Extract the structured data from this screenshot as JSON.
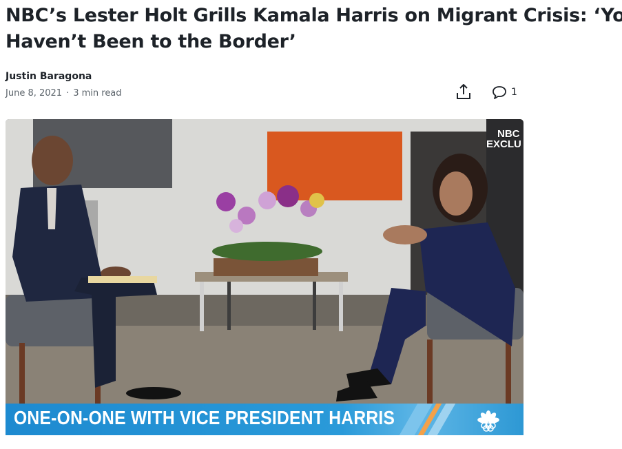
{
  "article": {
    "headline_line1": "NBC’s Lester Holt Grills Kamala Harris on Migrant Crisis: ‘You",
    "headline_line2": "Haven’t Been to the Border’",
    "author": "Justin Baragona",
    "date": "June 8, 2021",
    "separator": "·",
    "read_time": "3 min read"
  },
  "actions": {
    "share_icon": "share-icon",
    "comment_icon": "comment-icon",
    "comment_count": "1"
  },
  "video": {
    "network_bug_line1": "NBC",
    "network_bug_line2": "EXCLU",
    "lower_third_caption": "ONE-ON-ONE WITH VICE PRESIDENT HARRIS",
    "logo_icon": "nbc-peacock-icon"
  },
  "colors": {
    "lower_third_blue": "#1d8ad0",
    "text_primary": "#1d2228",
    "text_secondary": "#5b636a"
  }
}
